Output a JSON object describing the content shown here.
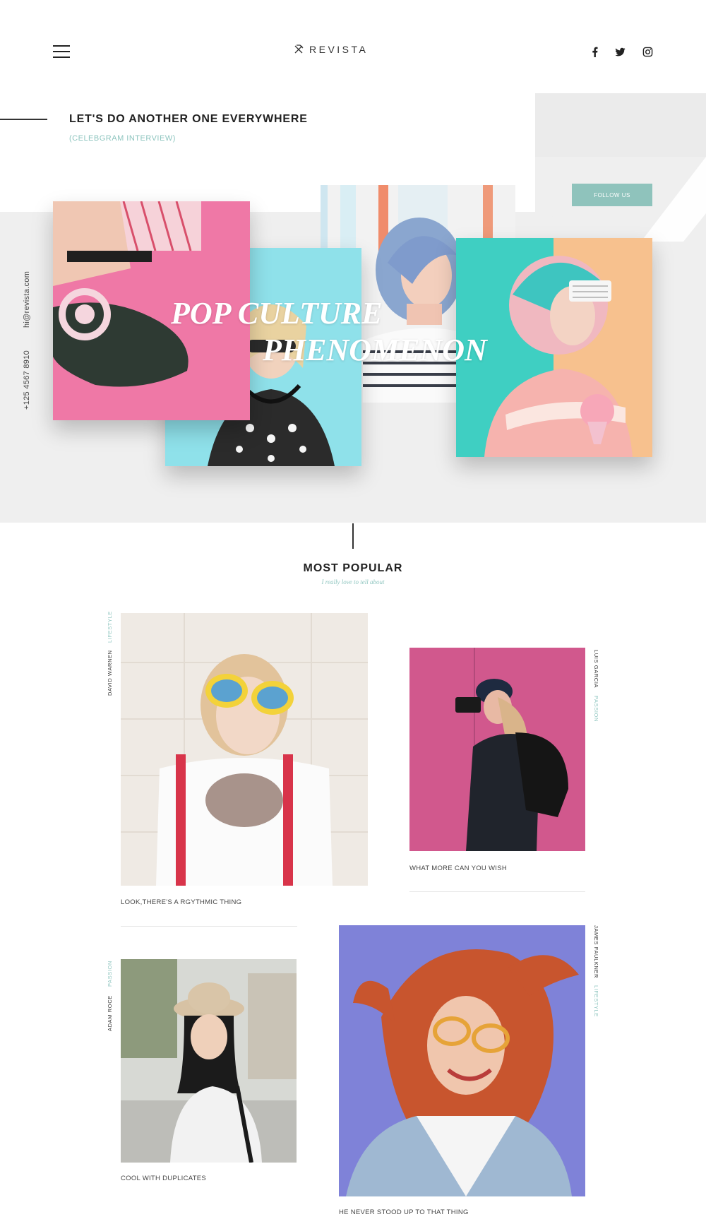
{
  "header": {
    "menu_icon": "hamburger-icon",
    "logo_icon": "revista-logo-icon",
    "logo_text": "REVISTA",
    "social": [
      {
        "name": "facebook",
        "icon": "facebook-icon"
      },
      {
        "name": "twitter",
        "icon": "twitter-icon"
      },
      {
        "name": "instagram",
        "icon": "instagram-icon"
      }
    ]
  },
  "hero": {
    "title": "LET'S DO ANOTHER ONE EVERYWHERE",
    "subtitle": "(CELEBGRAM INTERVIEW)",
    "follow_label": "FOLLOW US",
    "headline_line1": "POP CULTURE",
    "headline_line2": "PHENOMENON",
    "email": "hi@revista.com",
    "phone": "+125 4567 8910",
    "colors": {
      "accent": "#8fc3bc",
      "pink": "#ee7aa6",
      "cyan": "#5fd6d6",
      "peach": "#f7c18e",
      "bg": "#efefef"
    }
  },
  "popular": {
    "title": "MOST POPULAR",
    "subtitle": "I really love to tell about",
    "cards": [
      {
        "author": "DAVID WARNEN",
        "category": "LIFESTYLE",
        "caption": "LOOK,THERE'S A RGYTHMIC THING"
      },
      {
        "author": "LUIS GARCIA",
        "category": "PASSION",
        "caption": "WHAT MORE CAN YOU WISH"
      },
      {
        "author": "ADAM ROCE",
        "category": "PASSION",
        "caption": "COOL WITH DUPLICATES"
      },
      {
        "author": "JAMES FAULKNER",
        "category": "LIFESTYLE",
        "caption": "HE NEVER STOOD UP TO THAT THING"
      }
    ]
  }
}
